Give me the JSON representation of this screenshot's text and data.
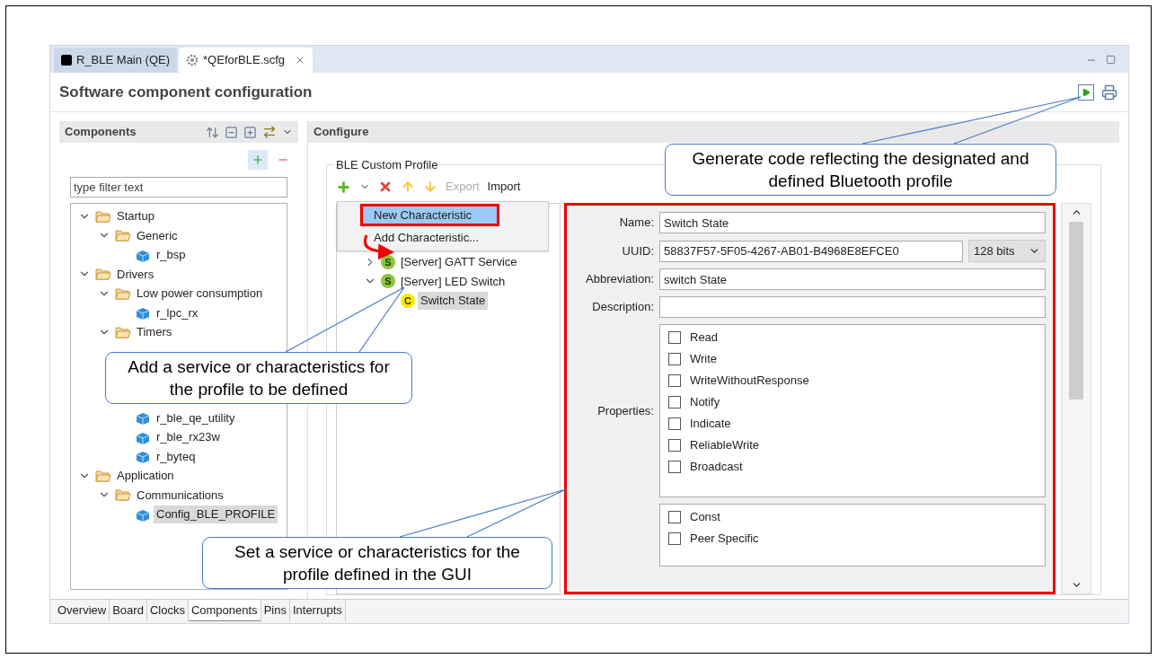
{
  "tabs": [
    {
      "label": "R_BLE Main (QE)",
      "selected": false,
      "kind": "perspective"
    },
    {
      "label": "*QEforBLE.scfg",
      "selected": true,
      "kind": "editor"
    }
  ],
  "editor_title": "Software component configuration",
  "components": {
    "title": "Components",
    "filter_placeholder": "type filter text",
    "tree_upper": [
      {
        "label": "Startup",
        "kind": "folder",
        "expanded": true,
        "children": [
          {
            "label": "Generic",
            "kind": "folder",
            "expanded": true,
            "children": [
              {
                "label": "r_bsp",
                "kind": "component",
                "selected": false
              }
            ]
          }
        ]
      },
      {
        "label": "Drivers",
        "kind": "folder",
        "expanded": true,
        "children": [
          {
            "label": "Low power consumption",
            "kind": "folder",
            "expanded": true,
            "children": [
              {
                "label": "r_lpc_rx",
                "kind": "component",
                "selected": false
              }
            ]
          },
          {
            "label": "Timers",
            "kind": "folder",
            "expanded": true
          }
        ]
      }
    ],
    "tree_continued": [
      {
        "label": "r_ble_qe_utility",
        "kind": "component",
        "selected": false
      },
      {
        "label": "r_ble_rx23w",
        "kind": "component",
        "selected": false
      },
      {
        "label": "r_byteq",
        "kind": "component",
        "selected": false
      }
    ],
    "tree_lower": [
      {
        "label": "Application",
        "kind": "folder",
        "expanded": true,
        "children": [
          {
            "label": "Communications",
            "kind": "folder",
            "expanded": true,
            "children": [
              {
                "label": "Config_BLE_PROFILE",
                "kind": "component",
                "selected": true
              }
            ]
          }
        ]
      }
    ]
  },
  "configure": {
    "title": "Configure",
    "group": "BLE Custom Profile",
    "toolbar": [
      {
        "label": "Export",
        "disabled": true
      },
      {
        "label": "Import",
        "disabled": false
      }
    ],
    "menu": [
      {
        "label": "New Characteristic",
        "selected": true
      },
      {
        "label": "Add Characteristic...",
        "selected": false
      }
    ],
    "tree": [
      {
        "label": "[Server] GATT Service",
        "kind": "service",
        "badge": "S",
        "expanded": false,
        "selected": false
      },
      {
        "label": "[Server] LED Switch",
        "kind": "service",
        "badge": "S",
        "expanded": true,
        "selected": false,
        "children": [
          {
            "label": "Switch State",
            "kind": "characteristic",
            "badge": "C",
            "selected": true
          }
        ]
      }
    ],
    "fields": [
      {
        "label": "Name:",
        "value": "Switch State"
      },
      {
        "label": "UUID:",
        "value": "58837F57-5F05-4267-AB01-B4968E8EFCE0",
        "unit": "128 bits"
      },
      {
        "label": "Abbreviation:",
        "value": "switch State"
      },
      {
        "label": "Description:"
      }
    ],
    "properties_label": "Properties:",
    "properties": [
      {
        "label": "Read",
        "checked": false
      },
      {
        "label": "Write",
        "checked": false
      },
      {
        "label": "WriteWithoutResponse",
        "checked": false
      },
      {
        "label": "Notify",
        "checked": false
      },
      {
        "label": "Indicate",
        "checked": false
      },
      {
        "label": "ReliableWrite",
        "checked": false
      },
      {
        "label": "Broadcast",
        "checked": false
      }
    ],
    "options": [
      {
        "label": "Const",
        "checked": false
      },
      {
        "label": "Peer Specific",
        "checked": false
      }
    ]
  },
  "bottom_tabs": [
    {
      "label": "Overview",
      "selected": false
    },
    {
      "label": "Board",
      "selected": false
    },
    {
      "label": "Clocks",
      "selected": false
    },
    {
      "label": "Components",
      "selected": true
    },
    {
      "label": "Pins",
      "selected": false
    },
    {
      "label": "Interrupts",
      "selected": false
    }
  ],
  "callouts": [
    {
      "text": "Generate code reflecting the designated and defined Bluetooth profile"
    },
    {
      "text": "Add a service or characteristics for the profile to be defined"
    },
    {
      "text": "Set a service or characteristics for the profile defined in the GUI"
    }
  ]
}
